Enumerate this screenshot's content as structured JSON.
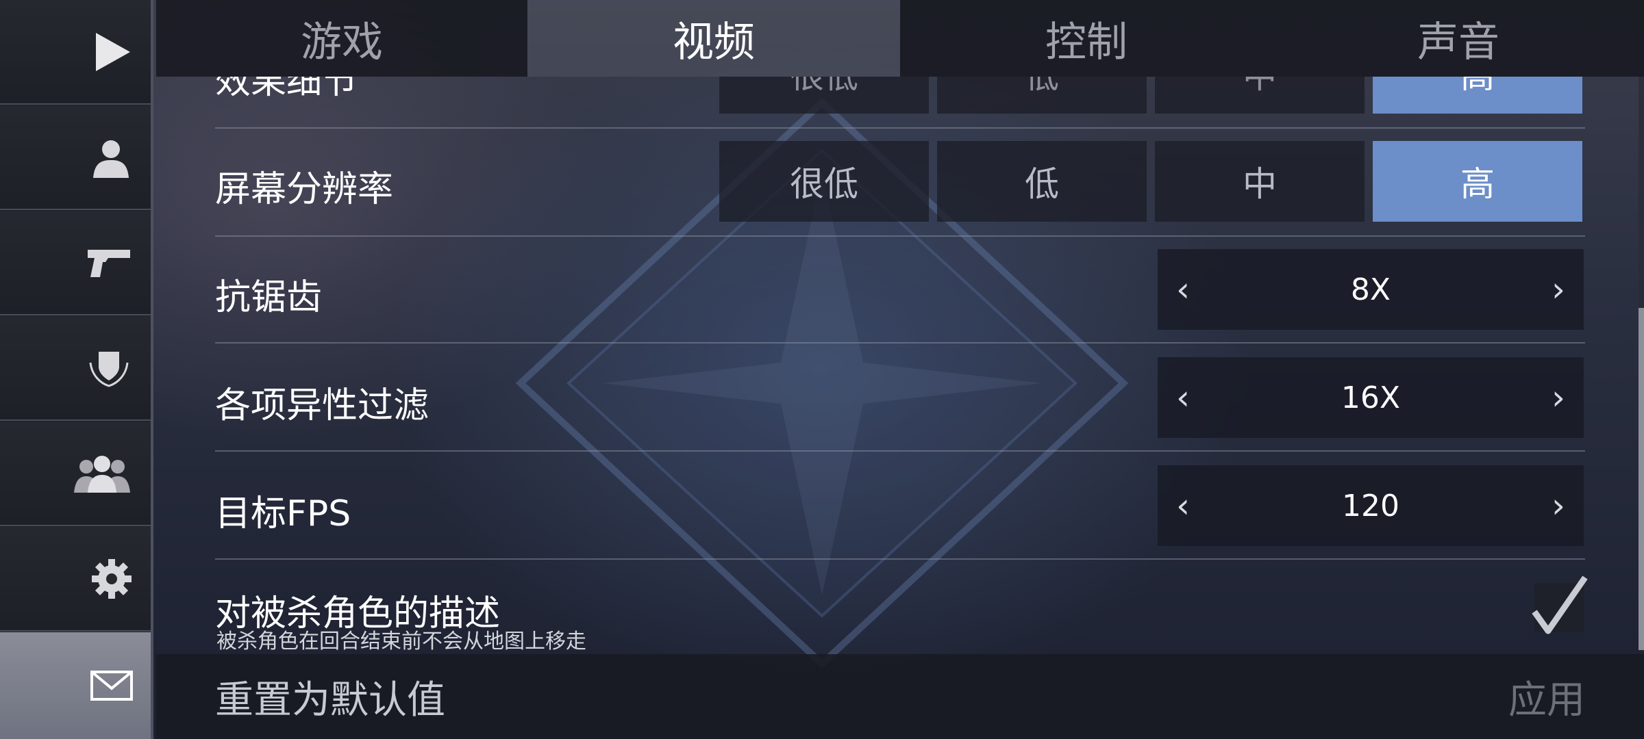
{
  "sidebar": {
    "items": [
      {
        "icon": "play-icon"
      },
      {
        "icon": "profile-icon"
      },
      {
        "icon": "pistol-icon"
      },
      {
        "icon": "shield-emblem-icon"
      },
      {
        "icon": "group-icon"
      },
      {
        "icon": "gear-icon"
      },
      {
        "icon": "mail-icon",
        "active": true
      }
    ]
  },
  "tabs": [
    {
      "label": "游戏"
    },
    {
      "label": "视频",
      "active": true
    },
    {
      "label": "控制"
    },
    {
      "label": "声音"
    }
  ],
  "settings": {
    "effects_detail": {
      "label": "效果细节",
      "options": [
        "很低",
        "低",
        "中",
        "高"
      ],
      "selected": "高"
    },
    "screen_resolution": {
      "label": "屏幕分辨率",
      "options": [
        "很低",
        "低",
        "中",
        "高"
      ],
      "selected": "高"
    },
    "antialiasing": {
      "label": "抗锯齿",
      "value": "8X"
    },
    "anisotropic_filtering": {
      "label": "各项异性过滤",
      "value": "16X"
    },
    "target_fps": {
      "label": "目标FPS",
      "value": "120"
    },
    "killed_character": {
      "label": "对被杀角色的描述",
      "description": "被杀角色在回合结束前不会从地图上移走",
      "checked": true
    }
  },
  "stepper_arrows": {
    "prev": "‹",
    "next": "›"
  },
  "footer": {
    "reset_label": "重置为默认值",
    "apply_label": "应用"
  },
  "colors": {
    "selected": "#6c8ec9",
    "sidebar_bg": "#1d1f26",
    "active_sidebar": "#7c7f8b"
  }
}
